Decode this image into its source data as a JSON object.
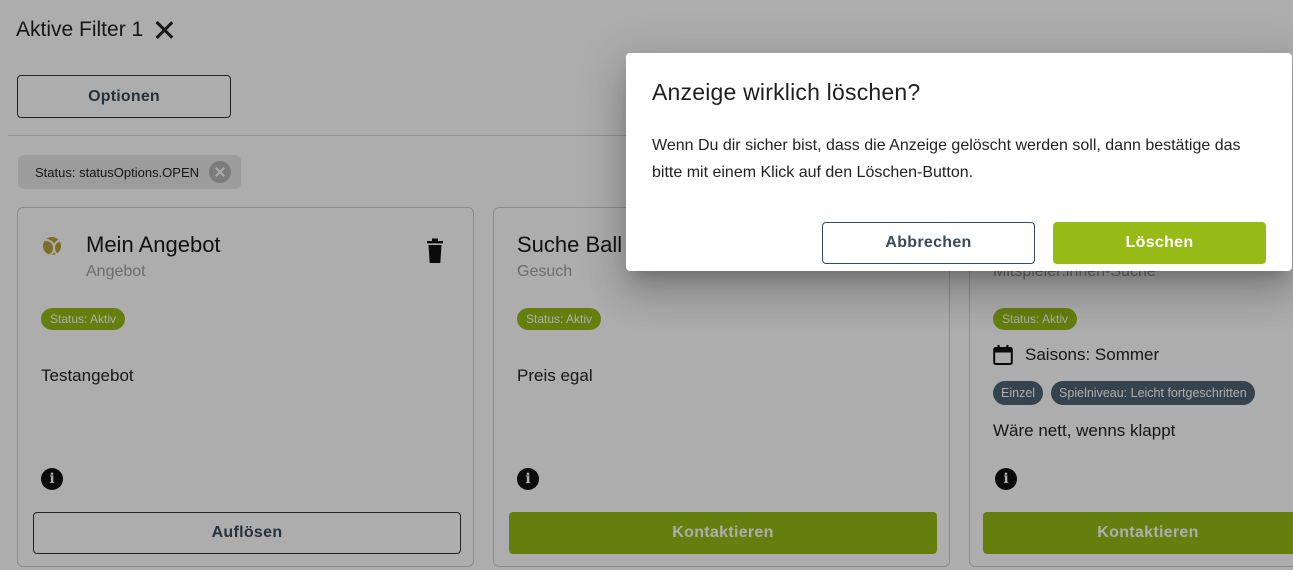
{
  "filter": {
    "active_label": "Aktive Filter 1",
    "options_button": "Optionen",
    "chip_label": "Status: statusOptions.OPEN"
  },
  "cards": [
    {
      "title": "Mein Angebot",
      "subtitle": "Angebot",
      "status": "Status: Aktiv",
      "text": "Testangebot",
      "action": "Auflösen"
    },
    {
      "title": "Suche Ball",
      "subtitle": "Gesuch",
      "status": "Status: Aktiv",
      "text": "Preis egal",
      "action": "Kontaktieren"
    },
    {
      "title": "",
      "subtitle": "Mitspieler:innen-Suche",
      "status": "Status: Aktiv",
      "season": "Saisons: Sommer",
      "tags": [
        "Einzel",
        "Spielniveau: Leicht fortgeschritten"
      ],
      "text": "Wäre nett, wenns klappt",
      "action": "Kontaktieren"
    }
  ],
  "dialog": {
    "title": "Anzeige wirklich löschen?",
    "body": "Wenn Du dir sicher bist, dass die Anzeige gelöscht werden soll, dann bestätige das bitte mit einem Klick auf den Löschen-Button.",
    "cancel": "Abbrechen",
    "confirm": "Löschen"
  },
  "colors": {
    "accent": "#96bb17",
    "tag": "#4e6373",
    "overlay": "rgba(0,0,0,0.32)"
  }
}
